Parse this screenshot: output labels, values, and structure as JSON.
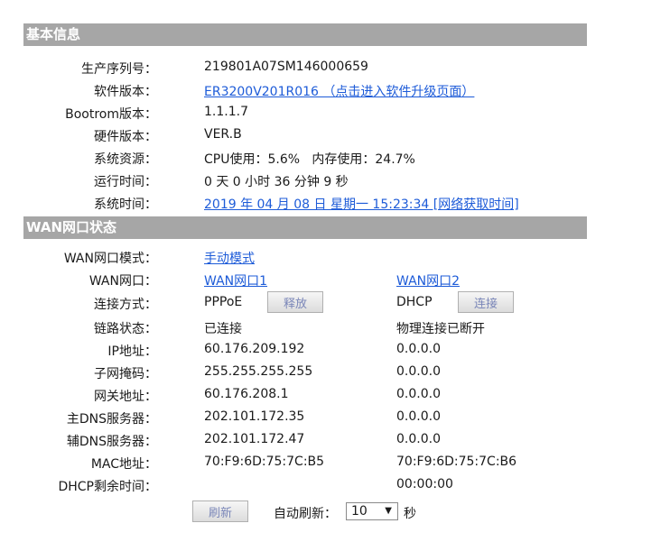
{
  "basic_info": {
    "header": "基本信息",
    "serial_label": "生产序列号：",
    "serial_value": "219801A07SM146000659",
    "software_label": "软件版本：",
    "software_value": "ER3200V201R016 （点击进入软件升级页面）",
    "bootrom_label": "Bootrom版本：",
    "bootrom_value": "1.1.1.7",
    "hardware_label": "硬件版本：",
    "hardware_value": "VER.B",
    "resources_label": "系统资源：",
    "resources_value": "CPU使用：5.6%   内存使用：24.7%",
    "uptime_label": "运行时间：",
    "uptime_value": "0 天 0 小时 36 分钟 9 秒",
    "systime_label": "系统时间：",
    "systime_value": "2019 年 04 月 08 日 星期一 15:23:34 [网络获取时间]"
  },
  "wan": {
    "header": "WAN网口状态",
    "mode_label": "WAN网口模式：",
    "mode_value": "手动模式",
    "port_label": "WAN网口：",
    "port1": "WAN网口1",
    "port2": "WAN网口2",
    "conn_label": "连接方式：",
    "conn1": "PPPoE",
    "conn1_btn": "释放",
    "conn2": "DHCP",
    "conn2_btn": "连接",
    "link_label": "链路状态：",
    "link1": "已连接",
    "link2": "物理连接已断开",
    "ip_label": "IP地址：",
    "ip1": "60.176.209.192",
    "ip2": "0.0.0.0",
    "mask_label": "子网掩码：",
    "mask1": "255.255.255.255",
    "mask2": "0.0.0.0",
    "gw_label": "网关地址：",
    "gw1": "60.176.208.1",
    "gw2": "0.0.0.0",
    "dns1_label": "主DNS服务器：",
    "dns1_1": "202.101.172.35",
    "dns1_2": "0.0.0.0",
    "dns2_label": "辅DNS服务器：",
    "dns2_1": "202.101.172.47",
    "dns2_2": "0.0.0.0",
    "mac_label": "MAC地址：",
    "mac1": "70:F9:6D:75:7C:B5",
    "mac2": "70:F9:6D:75:7C:B6",
    "lease_label": "DHCP剩余时间：",
    "lease1": "",
    "lease2": "00:00:00"
  },
  "footer": {
    "refresh_btn": "刷新",
    "auto_refresh_label": "自动刷新：",
    "interval_value": "10",
    "seconds_unit": "秒"
  },
  "icons": {
    "dropdown": "chevron-down-icon"
  },
  "colors": {
    "header_bg": "#a6a6a6",
    "link": "#1d5bd8"
  }
}
